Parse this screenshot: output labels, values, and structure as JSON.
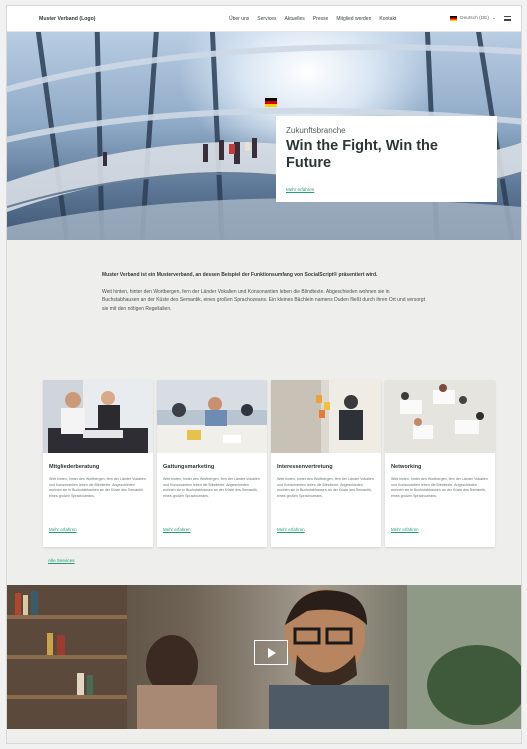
{
  "header": {
    "logo": "Muster Verband (Logo)",
    "nav": [
      "Über uns",
      "Services",
      "Aktuelles",
      "Presse",
      "Mitglied werden",
      "Kontakt"
    ],
    "language": "Deutsch (DE)"
  },
  "hero": {
    "eyebrow": "Zukunftsbranche",
    "title": "Win the Fight, Win the Future",
    "link": "Mehr erfahren"
  },
  "intro": {
    "lead": "Muster Verband ist ein Musterverband, an dessen Beispiel der Funktionsumfang von SocialScript® präsentiert wird.",
    "body": "Weit hinten, hinter den Wortbergen, fern der Länder Vokalien und Konsonantien leben die Blindtexte. Abgeschieden wohnen sie in Buchstabhausen an der Küste des Semantik, eines großen Sprachozeans. Ein kleines Bächlein namens Duden fließt durch ihren Ort und versorgt sie mit den nötigen Regelialien."
  },
  "cards": [
    {
      "title": "Mitgliederberatung",
      "text": "Weit hinten, hinter den Wortbergen, fern der Länder Vokalien und Konsonantien leben die Blindtexte. Abgeschieden wohnen sie in Buchstabhausen an der Küste des Semantik, eines großen Sprachozeans.",
      "link": "Mehr erfahren"
    },
    {
      "title": "Gattungsmarketing",
      "text": "Weit hinten, hinter den Wortbergen, fern der Länder Vokalien und Konsonantien leben die Blindtexte. Abgeschieden wohnen sie in Buchstabhausen an der Küste des Semantik, eines großen Sprachozeans.",
      "link": "Mehr erfahren"
    },
    {
      "title": "Interessenvertretung",
      "text": "Weit hinten, hinter den Wortbergen, fern der Länder Vokalien und Konsonantien leben die Blindtexte. Abgeschieden wohnen sie in Buchstabhausen an der Küste des Semantik, eines großen Sprachozeans.",
      "link": "Mehr erfahren"
    },
    {
      "title": "Networking",
      "text": "Weit hinten, hinter den Wortbergen, fern der Länder Vokalien und Konsonantien leben die Blindtexte. Abgeschieden wohnen sie in Buchstabhausen an der Küste des Semantik, eines großen Sprachozeans.",
      "link": "Mehr erfahren"
    }
  ],
  "more_link": "Alle Services",
  "video": {
    "play_icon": "play-icon"
  },
  "colors": {
    "accent": "#1fa07a",
    "background": "#eeeeec",
    "text": "#2c3636"
  }
}
